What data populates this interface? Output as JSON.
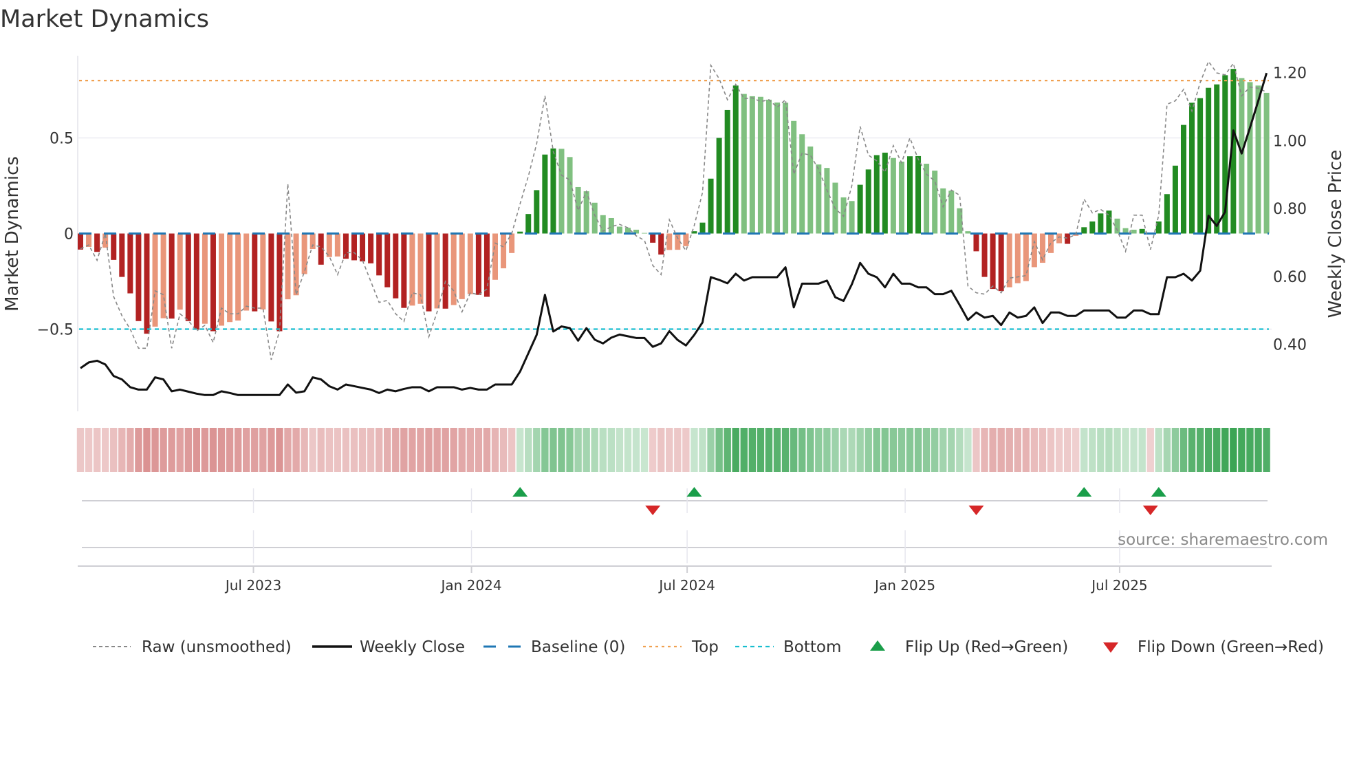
{
  "title": "Market Dynamics",
  "source_text": "source: sharemaestro.com",
  "colors": {
    "strong_red": "#b22222",
    "weak_red": "#e9967a",
    "strong_green": "#228b22",
    "weak_green": "#80c080",
    "raw": "#888888",
    "close": "#111111",
    "baseline": "#1f77b4",
    "top": "#f0a050",
    "bottom": "#17becf",
    "flip_up": "#1a9e4a",
    "flip_down": "#d62728"
  },
  "chart_data": {
    "type": "bar",
    "title": "Market Dynamics",
    "xlabel": "",
    "ylabel": "Market Dynamics",
    "y2label": "Weekly Close Price",
    "start_date": "2023-02-05",
    "freq_days": 7,
    "ylim": [
      -0.93,
      0.93
    ],
    "y2lim": [
      0.203,
      1.25
    ],
    "yticks": [
      {
        "value": 0.5,
        "label": "0.5"
      },
      {
        "value": 0,
        "label": "0"
      },
      {
        "value": -0.5,
        "label": "−0.5"
      }
    ],
    "y2ticks": [
      {
        "value": 1.2,
        "label": "1.20"
      },
      {
        "value": 1.0,
        "label": "1.00"
      },
      {
        "value": 0.8,
        "label": "0.80"
      },
      {
        "value": 0.6,
        "label": "0.60"
      },
      {
        "value": 0.4,
        "label": "0.40"
      }
    ],
    "xticks": [
      {
        "date": "2023-07-01",
        "label": "Jul 2023"
      },
      {
        "date": "2024-01-01",
        "label": "Jan 2024"
      },
      {
        "date": "2024-07-01",
        "label": "Jul 2024"
      },
      {
        "date": "2025-01-01",
        "label": "Jan 2025"
      },
      {
        "date": "2025-07-01",
        "label": "Jul 2025"
      }
    ],
    "top_level": 0.8,
    "bottom_level": -0.5,
    "baseline": 0,
    "series": [
      {
        "name": "Market Dynamics (smoothed)",
        "kind": "bar",
        "values": [
          -0.084,
          -0.07,
          -0.096,
          -0.074,
          -0.138,
          -0.227,
          -0.313,
          -0.458,
          -0.524,
          -0.487,
          -0.443,
          -0.445,
          -0.398,
          -0.458,
          -0.502,
          -0.472,
          -0.511,
          -0.482,
          -0.463,
          -0.455,
          -0.403,
          -0.407,
          -0.397,
          -0.46,
          -0.511,
          -0.344,
          -0.323,
          -0.212,
          -0.081,
          -0.163,
          -0.123,
          -0.12,
          -0.132,
          -0.14,
          -0.146,
          -0.156,
          -0.219,
          -0.281,
          -0.339,
          -0.389,
          -0.377,
          -0.368,
          -0.407,
          -0.392,
          -0.393,
          -0.374,
          -0.343,
          -0.317,
          -0.321,
          -0.331,
          -0.242,
          -0.182,
          -0.102,
          0.01,
          0.102,
          0.227,
          0.413,
          0.445,
          0.443,
          0.4,
          0.243,
          0.221,
          0.161,
          0.096,
          0.081,
          0.036,
          0.03,
          0.02,
          0.003,
          -0.048,
          -0.11,
          -0.086,
          -0.085,
          -0.066,
          0.012,
          0.057,
          0.287,
          0.5,
          0.646,
          0.774,
          0.73,
          0.718,
          0.715,
          0.7,
          0.685,
          0.684,
          0.589,
          0.519,
          0.455,
          0.361,
          0.343,
          0.266,
          0.189,
          0.17,
          0.255,
          0.335,
          0.41,
          0.423,
          0.395,
          0.376,
          0.404,
          0.405,
          0.365,
          0.329,
          0.236,
          0.224,
          0.132,
          0.012,
          -0.093,
          -0.227,
          -0.29,
          -0.301,
          -0.281,
          -0.26,
          -0.249,
          -0.176,
          -0.153,
          -0.102,
          -0.051,
          -0.054,
          -0.012,
          0.033,
          0.063,
          0.105,
          0.12,
          0.078,
          0.028,
          0.02,
          0.024,
          -0.004,
          0.063,
          0.206,
          0.355,
          0.568,
          0.684,
          0.708,
          0.762,
          0.78,
          0.828,
          0.861,
          0.813,
          0.792,
          0.774,
          0.736
        ]
      },
      {
        "name": "Raw (unsmoothed)",
        "kind": "line",
        "values": [
          -0.08,
          -0.06,
          -0.14,
          0.0,
          -0.33,
          -0.43,
          -0.5,
          -0.6,
          -0.6,
          -0.3,
          -0.32,
          -0.6,
          -0.42,
          -0.455,
          -0.51,
          -0.48,
          -0.57,
          -0.39,
          -0.42,
          -0.42,
          -0.38,
          -0.39,
          -0.39,
          -0.66,
          -0.51,
          0.26,
          -0.32,
          -0.2,
          -0.06,
          -0.07,
          -0.12,
          -0.215,
          -0.1,
          -0.1,
          -0.14,
          -0.25,
          -0.36,
          -0.35,
          -0.42,
          -0.46,
          -0.31,
          -0.32,
          -0.54,
          -0.41,
          -0.25,
          -0.3,
          -0.41,
          -0.31,
          -0.32,
          -0.29,
          -0.05,
          -0.07,
          0.0,
          0.155,
          0.3,
          0.47,
          0.72,
          0.43,
          0.305,
          0.28,
          0.12,
          0.22,
          0.096,
          0.012,
          0.036,
          0.048,
          0.03,
          -0.012,
          -0.036,
          -0.167,
          -0.215,
          0.072,
          -0.024,
          -0.09,
          0.042,
          0.215,
          0.88,
          0.81,
          0.7,
          0.78,
          0.705,
          0.71,
          0.69,
          0.7,
          0.66,
          0.7,
          0.31,
          0.42,
          0.41,
          0.335,
          0.227,
          0.13,
          0.09,
          0.25,
          0.56,
          0.41,
          0.38,
          0.32,
          0.46,
          0.37,
          0.5,
          0.39,
          0.31,
          0.275,
          0.14,
          0.227,
          0.2,
          -0.275,
          -0.31,
          -0.317,
          -0.275,
          -0.31,
          -0.233,
          -0.227,
          -0.22,
          -0.042,
          -0.138,
          -0.048,
          -0.018,
          -0.024,
          -0.006,
          0.18,
          0.108,
          0.126,
          0.096,
          0.018,
          -0.093,
          0.096,
          0.096,
          -0.084,
          0.096,
          0.676,
          0.694,
          0.754,
          0.64,
          0.79,
          0.9,
          0.84,
          0.83,
          0.89,
          0.72,
          0.766,
          0.76,
          0.74
        ]
      },
      {
        "name": "Weekly Close",
        "kind": "line",
        "axis": "right",
        "values": [
          0.33,
          0.347,
          0.352,
          0.341,
          0.307,
          0.297,
          0.274,
          0.267,
          0.267,
          0.303,
          0.297,
          0.262,
          0.267,
          0.261,
          0.255,
          0.251,
          0.251,
          0.262,
          0.257,
          0.251,
          0.251,
          0.251,
          0.251,
          0.251,
          0.251,
          0.282,
          0.258,
          0.262,
          0.303,
          0.297,
          0.277,
          0.267,
          0.282,
          0.277,
          0.272,
          0.267,
          0.257,
          0.267,
          0.262,
          0.269,
          0.274,
          0.274,
          0.262,
          0.274,
          0.274,
          0.274,
          0.267,
          0.272,
          0.267,
          0.267,
          0.282,
          0.282,
          0.282,
          0.32,
          0.374,
          0.428,
          0.546,
          0.438,
          0.453,
          0.448,
          0.411,
          0.448,
          0.414,
          0.403,
          0.42,
          0.429,
          0.424,
          0.419,
          0.419,
          0.393,
          0.403,
          0.439,
          0.413,
          0.397,
          0.428,
          0.465,
          0.598,
          0.59,
          0.58,
          0.608,
          0.588,
          0.598,
          0.598,
          0.598,
          0.598,
          0.627,
          0.509,
          0.579,
          0.579,
          0.579,
          0.588,
          0.539,
          0.528,
          0.577,
          0.64,
          0.608,
          0.598,
          0.568,
          0.608,
          0.579,
          0.579,
          0.568,
          0.568,
          0.548,
          0.548,
          0.558,
          0.516,
          0.472,
          0.494,
          0.479,
          0.484,
          0.457,
          0.494,
          0.479,
          0.484,
          0.509,
          0.463,
          0.494,
          0.494,
          0.484,
          0.484,
          0.5,
          0.5,
          0.5,
          0.5,
          0.479,
          0.479,
          0.5,
          0.5,
          0.489,
          0.489,
          0.598,
          0.598,
          0.608,
          0.588,
          0.617,
          0.779,
          0.749,
          0.79,
          1.03,
          0.962,
          1.038,
          1.117,
          1.199
        ]
      }
    ],
    "flips": [
      {
        "index": 53,
        "dir": "up"
      },
      {
        "index": 69,
        "dir": "down"
      },
      {
        "index": 74,
        "dir": "up"
      },
      {
        "index": 108,
        "dir": "down"
      },
      {
        "index": 121,
        "dir": "up"
      },
      {
        "index": 129,
        "dir": "down"
      },
      {
        "index": 130,
        "dir": "up"
      }
    ],
    "legend": {
      "placement": "bottom",
      "items": [
        {
          "key": "raw",
          "label": "Raw (unsmoothed)"
        },
        {
          "key": "close",
          "label": "Weekly Close"
        },
        {
          "key": "baseline",
          "label": "Baseline (0)"
        },
        {
          "key": "top",
          "label": "Top"
        },
        {
          "key": "bottom",
          "label": "Bottom"
        },
        {
          "key": "flip_up",
          "label": "Flip Up (Red→Green)"
        },
        {
          "key": "flip_down",
          "label": "Flip Down (Green→Red)"
        }
      ]
    }
  }
}
